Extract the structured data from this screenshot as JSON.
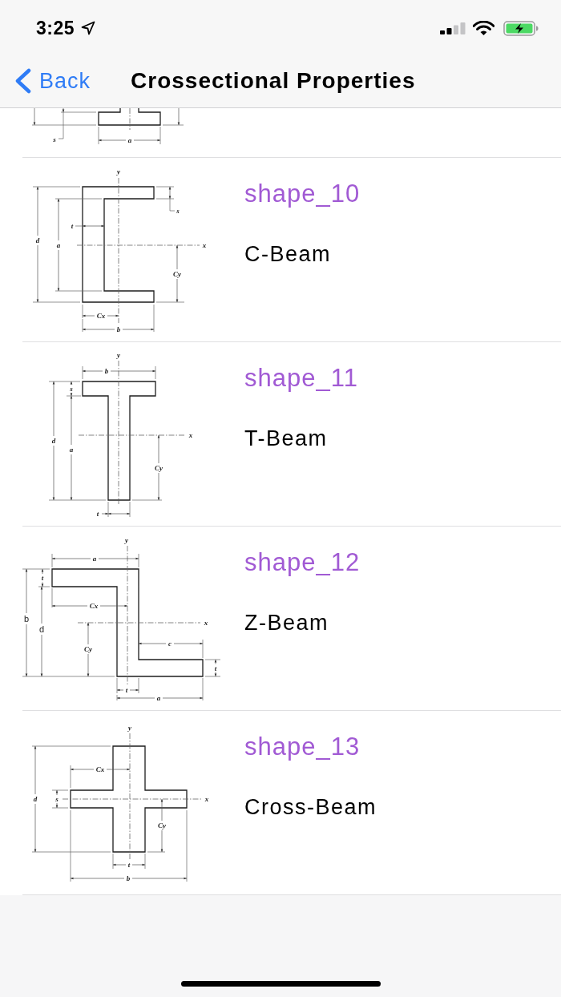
{
  "status_bar": {
    "time": "3:25"
  },
  "nav_bar": {
    "back": "Back",
    "title": "Crossectional Properties"
  },
  "partial_row": {
    "drawing": {
      "kind": "i-beam-bottom",
      "labels": [
        "s",
        "a"
      ]
    }
  },
  "rows": [
    {
      "title": "shape_10",
      "subtitle": "C-Beam",
      "drawing": {
        "kind": "c-beam",
        "labels": [
          "y",
          "s",
          "t",
          "d",
          "a",
          "x",
          "Cy",
          "Cx",
          "b"
        ]
      }
    },
    {
      "title": "shape_11",
      "subtitle": "T-Beam",
      "drawing": {
        "kind": "t-beam",
        "labels": [
          "y",
          "b",
          "s",
          "x",
          "d",
          "a",
          "Cy",
          "t"
        ]
      }
    },
    {
      "title": "shape_12",
      "subtitle": "Z-Beam",
      "drawing": {
        "kind": "z-beam",
        "labels": [
          "y",
          "a",
          "t",
          "Cx",
          "b",
          "x",
          "d",
          "c",
          "Cy",
          "t",
          "t",
          "a"
        ]
      }
    },
    {
      "title": "shape_13",
      "subtitle": "Cross-Beam",
      "drawing": {
        "kind": "cross-beam",
        "labels": [
          "y",
          "Cx",
          "d",
          "s",
          "x",
          "Cy",
          "t",
          "b"
        ]
      }
    }
  ]
}
